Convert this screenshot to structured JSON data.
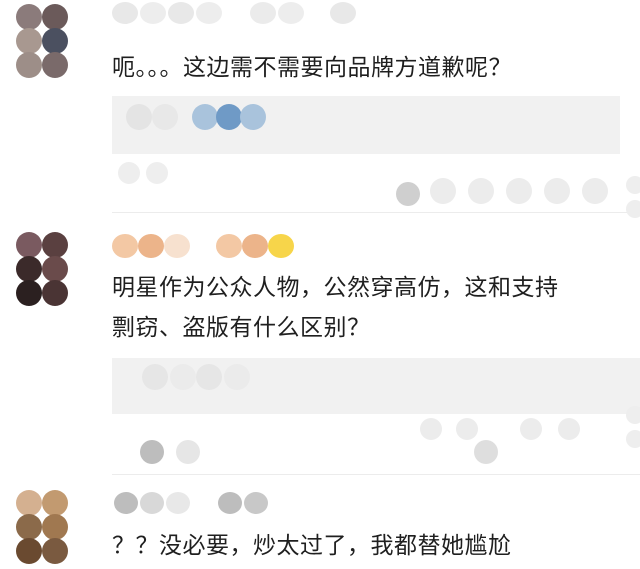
{
  "comments": [
    {
      "text": "呃。。。这边需不需要向品牌方道歉呢？",
      "colors": {
        "avatar": [
          "#8b7b7b",
          "#5a4a4a",
          "#9d8e88",
          "#4b5060",
          "#b8a8a0",
          "#7a6a6a"
        ]
      }
    },
    {
      "text_line1": "明星作为公众人物，公然穿高仿，这和支持",
      "text_line2": "剽窃、盗版有什么区别？",
      "colors": {
        "avatar": [
          "#5a4040",
          "#3b2a2a",
          "#6a4b4b",
          "#2b2020",
          "#7a5a50",
          "#3a2a2a"
        ]
      }
    },
    {
      "text": "？？没必要，炒太过了，我都替她尴尬",
      "colors": {
        "avatar": [
          "#c29a70",
          "#8b6a4a",
          "#a07850",
          "#6a4a30",
          "#d4b090",
          "#7a5a40"
        ]
      }
    }
  ],
  "colors": {
    "reply_box": "#f1f1f1",
    "blur_gray": "#e6e6e6",
    "blur_blue": "#a9c3dc",
    "blur_peach": "#f3c8a4",
    "blur_yellow": "#f7d54a",
    "blur_dark": "#bdbdbd"
  }
}
